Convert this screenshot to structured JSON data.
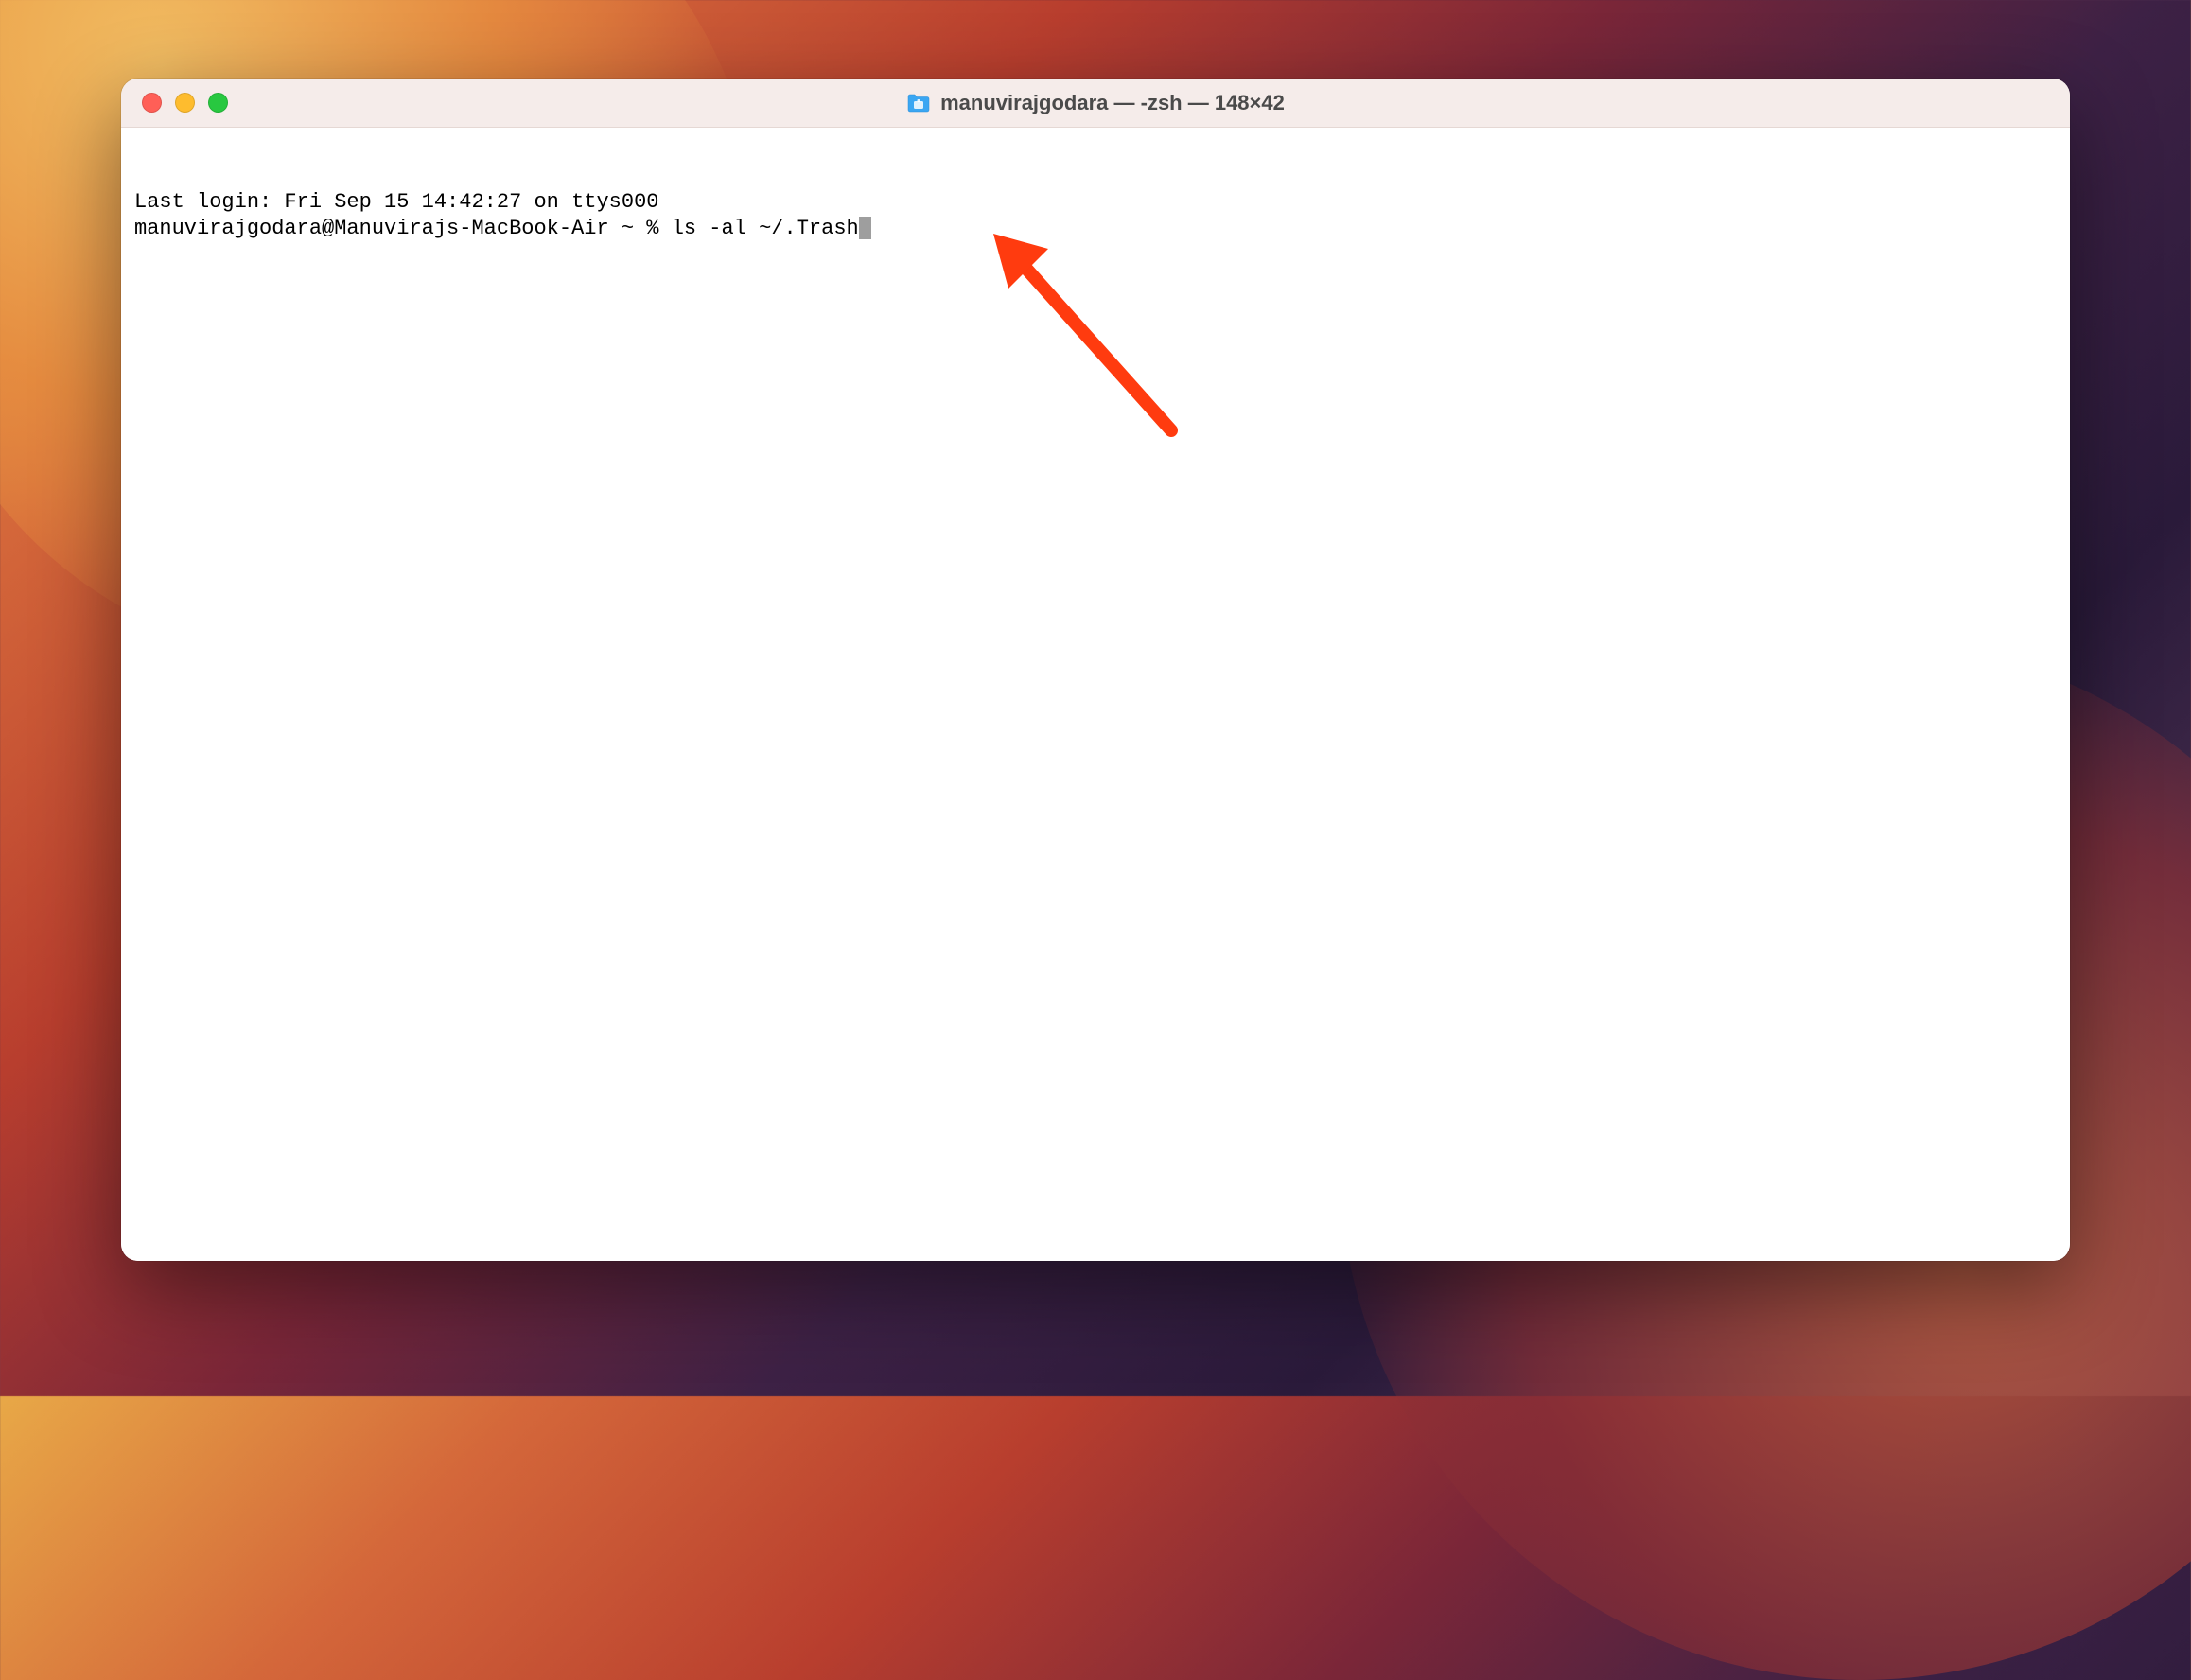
{
  "window": {
    "title": "manuvirajgodara — -zsh — 148×42"
  },
  "terminal": {
    "last_login_line": "Last login: Fri Sep 15 14:42:27 on ttys000",
    "prompt": "manuvirajgodara@Manuvirajs-MacBook-Air ~ % ",
    "command": "ls -al ~/.Trash"
  }
}
